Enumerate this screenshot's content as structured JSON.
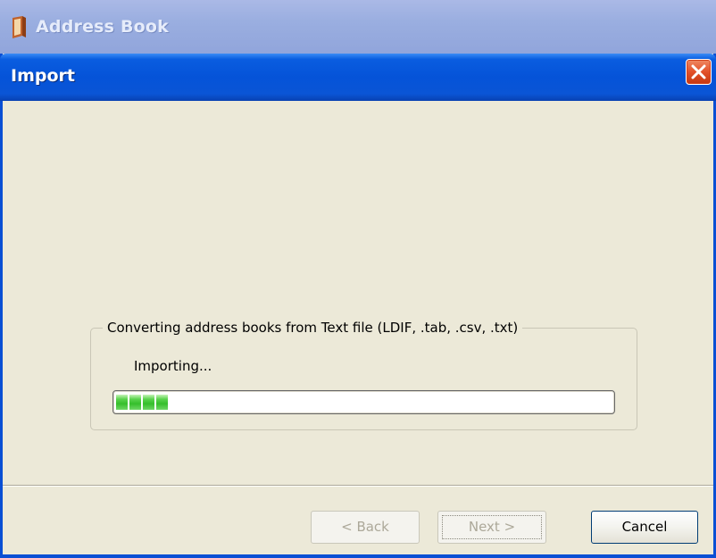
{
  "background_window": {
    "title": "Address Book",
    "icon": "address-book-icon"
  },
  "dialog": {
    "title": "Import",
    "close_icon": "close-icon",
    "group_label": "Converting address books from Text file (LDIF, .tab, .csv, .txt)",
    "status": "Importing...",
    "progress_fraction": 0.12
  },
  "buttons": {
    "back": "< Back",
    "next": "Next >",
    "cancel": "Cancel"
  },
  "colors": {
    "dialog_bg": "#ece9d8",
    "titlebar_blue": "#0553d8",
    "progress_green": "#35be2b",
    "close_red": "#e2512a"
  }
}
